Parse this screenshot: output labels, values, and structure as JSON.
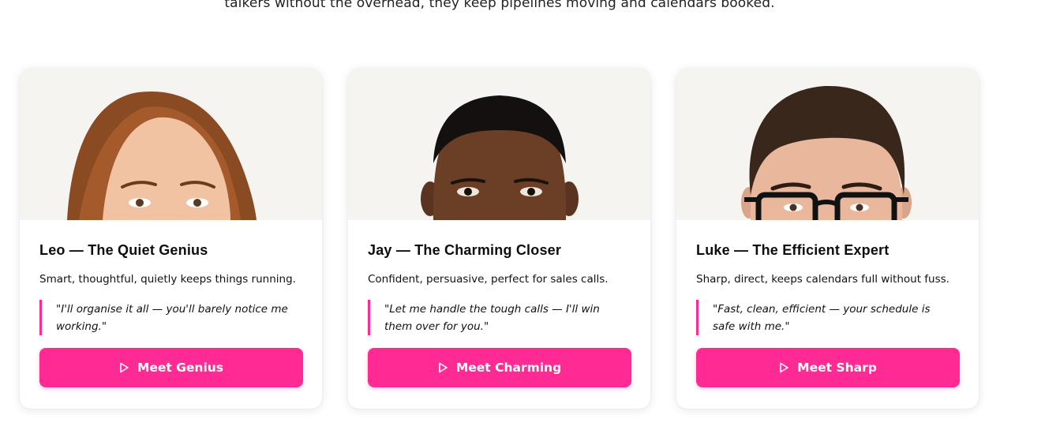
{
  "intro": {
    "text": "talkers without the overhead, they keep pipelines moving and calendars booked."
  },
  "cards": [
    {
      "title": "Leo — The Quiet Genius",
      "description": "Smart, thoughtful, quietly keeps things running.",
      "quote": "\"I'll organise it all — you'll barely notice me working.\"",
      "button_label": "Meet Genius",
      "button_icon": "play-icon"
    },
    {
      "title": "Jay — The Charming Closer",
      "description": "Confident, persuasive, perfect for sales calls.",
      "quote": "\"Let me handle the tough calls — I'll win them over for you.\"",
      "button_label": "Meet Charming",
      "button_icon": "play-icon"
    },
    {
      "title": "Luke — The Efficient Expert",
      "description": "Sharp, direct, keeps calendars full without fuss.",
      "quote": "\"Fast, clean, efficient — your schedule is safe with me.\"",
      "button_label": "Meet Sharp",
      "button_icon": "play-icon"
    }
  ],
  "colors": {
    "accent": "#ff2a93",
    "photo_background": "#f5f4f1"
  }
}
